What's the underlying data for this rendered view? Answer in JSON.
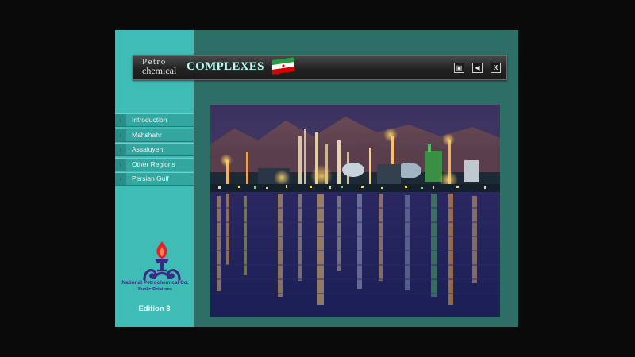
{
  "header": {
    "title_line1": "Petro",
    "title_line2": "chemical",
    "title_main": "COMPLEXES",
    "flag_icon": "iran-flag-icon",
    "controls": [
      {
        "name": "print-icon",
        "glyph": "▣"
      },
      {
        "name": "sound-icon",
        "glyph": "◀)"
      },
      {
        "name": "close-icon",
        "glyph": "X"
      }
    ]
  },
  "sidebar": {
    "items": [
      {
        "label": "Introduction"
      },
      {
        "label": "Mahshahr"
      },
      {
        "label": "Assaluyeh"
      },
      {
        "label": "Other Regions"
      },
      {
        "label": "Persian Gulf"
      }
    ],
    "org_name": "National Petrochemical Co.",
    "org_dept": "Public Relations",
    "edition": "Edition 8"
  },
  "colors": {
    "background": "#0a0a0a",
    "panel": "#2d6f66",
    "sidebar": "#3fbcb6",
    "logo": "#3b2a82",
    "flame": "#e0252a"
  },
  "main": {
    "image_icon": "refinery-night-photo"
  }
}
